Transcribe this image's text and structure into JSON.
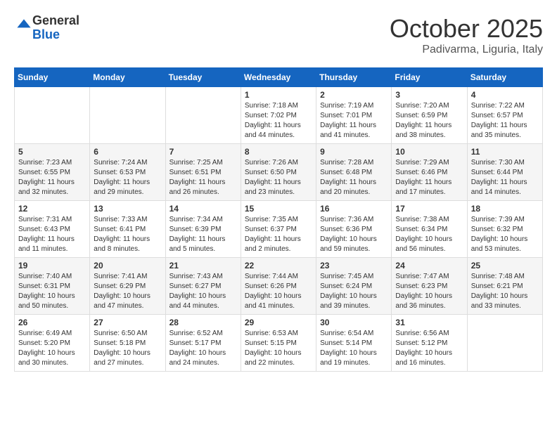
{
  "header": {
    "logo_general": "General",
    "logo_blue": "Blue",
    "month": "October 2025",
    "location": "Padivarma, Liguria, Italy"
  },
  "weekdays": [
    "Sunday",
    "Monday",
    "Tuesday",
    "Wednesday",
    "Thursday",
    "Friday",
    "Saturday"
  ],
  "weeks": [
    [
      {
        "day": "",
        "info": ""
      },
      {
        "day": "",
        "info": ""
      },
      {
        "day": "",
        "info": ""
      },
      {
        "day": "1",
        "info": "Sunrise: 7:18 AM\nSunset: 7:02 PM\nDaylight: 11 hours\nand 44 minutes."
      },
      {
        "day": "2",
        "info": "Sunrise: 7:19 AM\nSunset: 7:01 PM\nDaylight: 11 hours\nand 41 minutes."
      },
      {
        "day": "3",
        "info": "Sunrise: 7:20 AM\nSunset: 6:59 PM\nDaylight: 11 hours\nand 38 minutes."
      },
      {
        "day": "4",
        "info": "Sunrise: 7:22 AM\nSunset: 6:57 PM\nDaylight: 11 hours\nand 35 minutes."
      }
    ],
    [
      {
        "day": "5",
        "info": "Sunrise: 7:23 AM\nSunset: 6:55 PM\nDaylight: 11 hours\nand 32 minutes."
      },
      {
        "day": "6",
        "info": "Sunrise: 7:24 AM\nSunset: 6:53 PM\nDaylight: 11 hours\nand 29 minutes."
      },
      {
        "day": "7",
        "info": "Sunrise: 7:25 AM\nSunset: 6:51 PM\nDaylight: 11 hours\nand 26 minutes."
      },
      {
        "day": "8",
        "info": "Sunrise: 7:26 AM\nSunset: 6:50 PM\nDaylight: 11 hours\nand 23 minutes."
      },
      {
        "day": "9",
        "info": "Sunrise: 7:28 AM\nSunset: 6:48 PM\nDaylight: 11 hours\nand 20 minutes."
      },
      {
        "day": "10",
        "info": "Sunrise: 7:29 AM\nSunset: 6:46 PM\nDaylight: 11 hours\nand 17 minutes."
      },
      {
        "day": "11",
        "info": "Sunrise: 7:30 AM\nSunset: 6:44 PM\nDaylight: 11 hours\nand 14 minutes."
      }
    ],
    [
      {
        "day": "12",
        "info": "Sunrise: 7:31 AM\nSunset: 6:43 PM\nDaylight: 11 hours\nand 11 minutes."
      },
      {
        "day": "13",
        "info": "Sunrise: 7:33 AM\nSunset: 6:41 PM\nDaylight: 11 hours\nand 8 minutes."
      },
      {
        "day": "14",
        "info": "Sunrise: 7:34 AM\nSunset: 6:39 PM\nDaylight: 11 hours\nand 5 minutes."
      },
      {
        "day": "15",
        "info": "Sunrise: 7:35 AM\nSunset: 6:37 PM\nDaylight: 11 hours\nand 2 minutes."
      },
      {
        "day": "16",
        "info": "Sunrise: 7:36 AM\nSunset: 6:36 PM\nDaylight: 10 hours\nand 59 minutes."
      },
      {
        "day": "17",
        "info": "Sunrise: 7:38 AM\nSunset: 6:34 PM\nDaylight: 10 hours\nand 56 minutes."
      },
      {
        "day": "18",
        "info": "Sunrise: 7:39 AM\nSunset: 6:32 PM\nDaylight: 10 hours\nand 53 minutes."
      }
    ],
    [
      {
        "day": "19",
        "info": "Sunrise: 7:40 AM\nSunset: 6:31 PM\nDaylight: 10 hours\nand 50 minutes."
      },
      {
        "day": "20",
        "info": "Sunrise: 7:41 AM\nSunset: 6:29 PM\nDaylight: 10 hours\nand 47 minutes."
      },
      {
        "day": "21",
        "info": "Sunrise: 7:43 AM\nSunset: 6:27 PM\nDaylight: 10 hours\nand 44 minutes."
      },
      {
        "day": "22",
        "info": "Sunrise: 7:44 AM\nSunset: 6:26 PM\nDaylight: 10 hours\nand 41 minutes."
      },
      {
        "day": "23",
        "info": "Sunrise: 7:45 AM\nSunset: 6:24 PM\nDaylight: 10 hours\nand 39 minutes."
      },
      {
        "day": "24",
        "info": "Sunrise: 7:47 AM\nSunset: 6:23 PM\nDaylight: 10 hours\nand 36 minutes."
      },
      {
        "day": "25",
        "info": "Sunrise: 7:48 AM\nSunset: 6:21 PM\nDaylight: 10 hours\nand 33 minutes."
      }
    ],
    [
      {
        "day": "26",
        "info": "Sunrise: 6:49 AM\nSunset: 5:20 PM\nDaylight: 10 hours\nand 30 minutes."
      },
      {
        "day": "27",
        "info": "Sunrise: 6:50 AM\nSunset: 5:18 PM\nDaylight: 10 hours\nand 27 minutes."
      },
      {
        "day": "28",
        "info": "Sunrise: 6:52 AM\nSunset: 5:17 PM\nDaylight: 10 hours\nand 24 minutes."
      },
      {
        "day": "29",
        "info": "Sunrise: 6:53 AM\nSunset: 5:15 PM\nDaylight: 10 hours\nand 22 minutes."
      },
      {
        "day": "30",
        "info": "Sunrise: 6:54 AM\nSunset: 5:14 PM\nDaylight: 10 hours\nand 19 minutes."
      },
      {
        "day": "31",
        "info": "Sunrise: 6:56 AM\nSunset: 5:12 PM\nDaylight: 10 hours\nand 16 minutes."
      },
      {
        "day": "",
        "info": ""
      }
    ]
  ]
}
